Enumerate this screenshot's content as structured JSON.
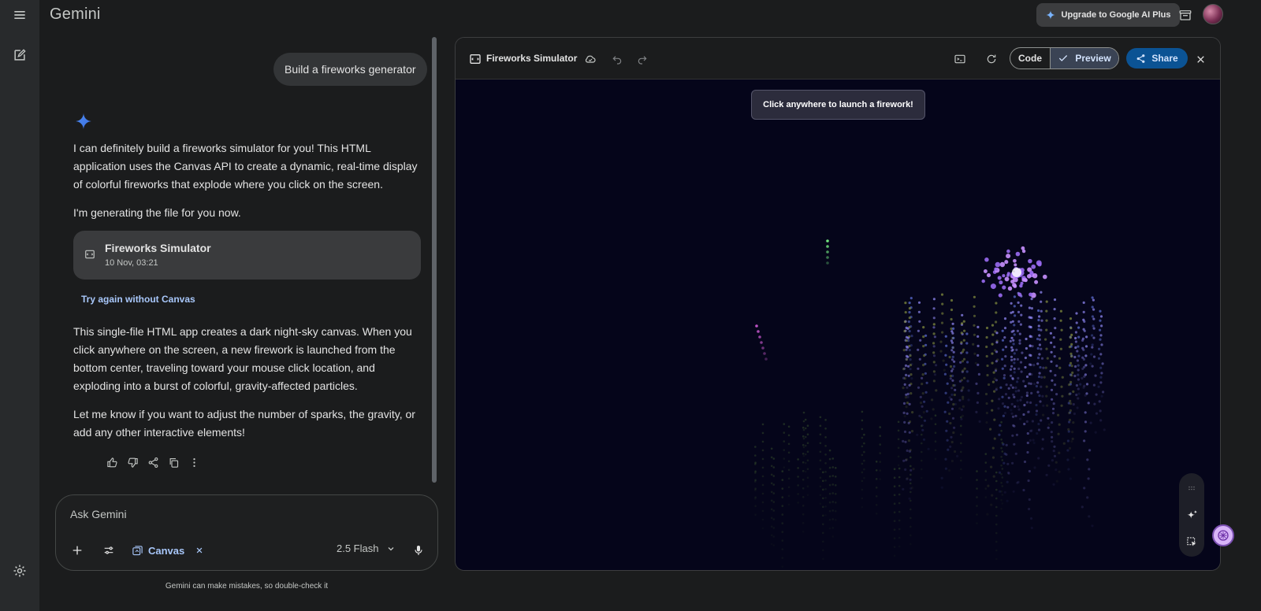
{
  "topbar": {
    "brand": "Gemini",
    "upgrade_label": "Upgrade to Google AI Plus"
  },
  "rail": {
    "menu_icon": "menu-icon",
    "new_chat_icon": "edit-icon",
    "settings_icon": "gear-icon"
  },
  "chat": {
    "user_message": "Build a fireworks generator",
    "reply_intro": "I can definitely build a fireworks simulator for you! This HTML application uses the Canvas API to create a dynamic, real-time display of colorful fireworks that explode where you click on the screen.",
    "reply_generating": "I'm generating the file for you now.",
    "file_card": {
      "title": "Fireworks Simulator",
      "date": "10 Nov, 03:21"
    },
    "retry_link": "Try again without Canvas",
    "reply_details": "This single-file HTML app creates a dark night-sky canvas. When you click anywhere on the screen, a new firework is launched from the bottom center, traveling toward your mouse click location, and exploding into a burst of colorful, gravity-affected particles.",
    "reply_followup": "Let me know if you want to adjust the number of sparks, the gravity, or add any other interactive elements!"
  },
  "composer": {
    "placeholder": "Ask Gemini",
    "canvas_chip": "Canvas",
    "model": "2.5 Flash",
    "disclaimer": "Gemini can make mistakes, so double-check it"
  },
  "panel": {
    "title": "Fireworks Simulator",
    "code_label": "Code",
    "preview_label": "Preview",
    "share_label": "Share",
    "hint": "Click anywhere to launch a firework!"
  },
  "colors": {
    "accent": "#a8c7fa",
    "share_bg": "#0b5394",
    "sky": "#05051a",
    "burst": "#b07cf0"
  }
}
